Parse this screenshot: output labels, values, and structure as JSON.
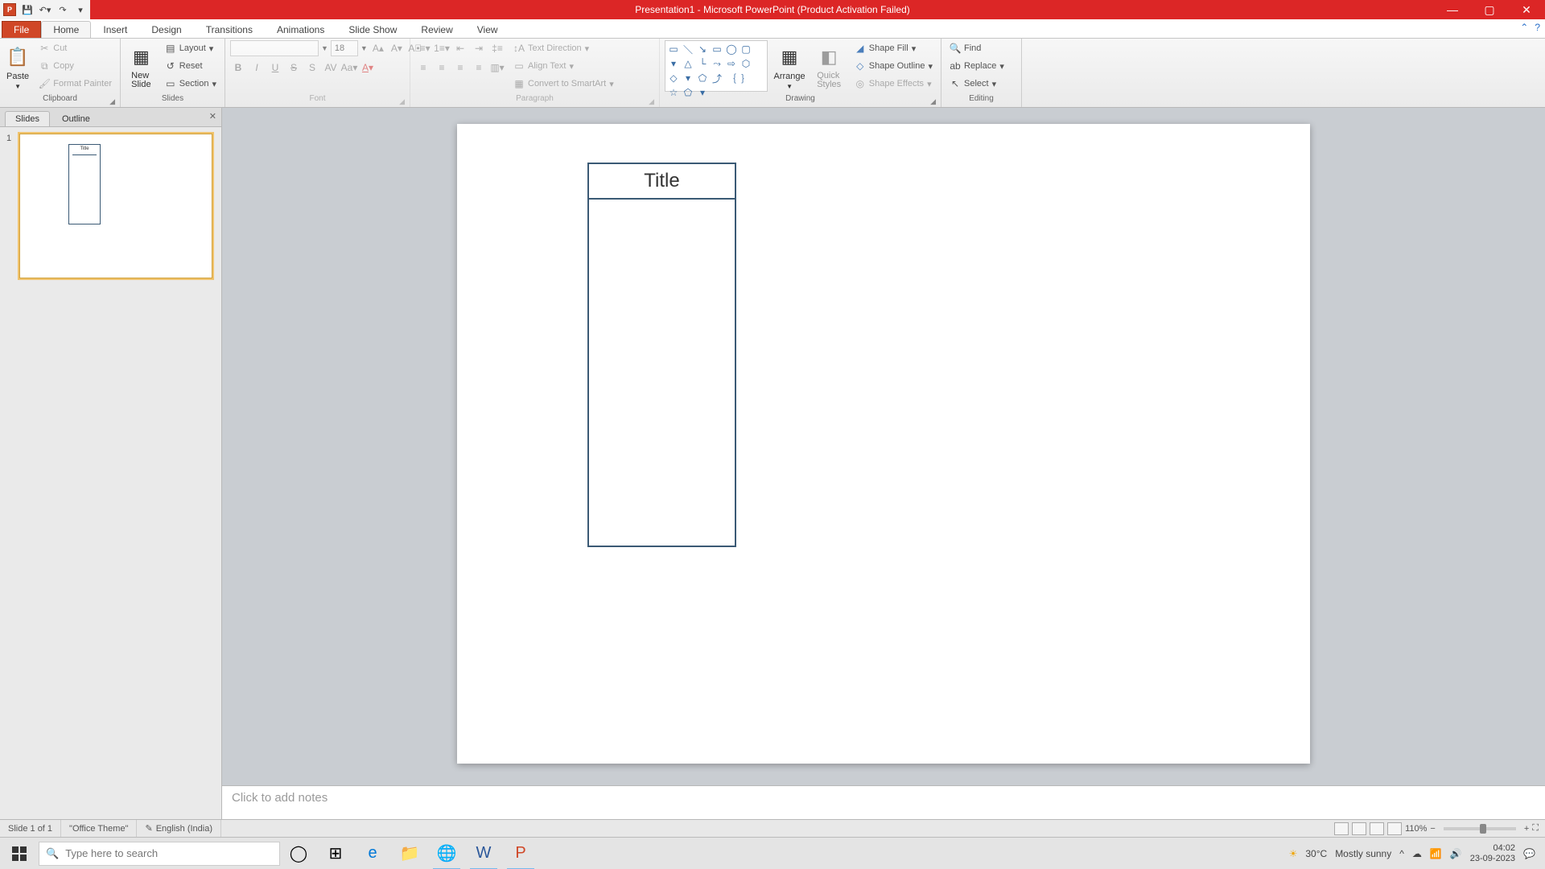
{
  "title": "Presentation1 - Microsoft PowerPoint (Product Activation Failed)",
  "tabs": {
    "file": "File",
    "home": "Home",
    "insert": "Insert",
    "design": "Design",
    "transitions": "Transitions",
    "animations": "Animations",
    "slideshow": "Slide Show",
    "review": "Review",
    "view": "View"
  },
  "ribbon": {
    "clipboard": {
      "label": "Clipboard",
      "paste": "Paste",
      "cut": "Cut",
      "copy": "Copy",
      "format_painter": "Format Painter"
    },
    "slides": {
      "label": "Slides",
      "new_slide": "New\nSlide",
      "layout": "Layout",
      "reset": "Reset",
      "section": "Section"
    },
    "font": {
      "label": "Font",
      "size": "18"
    },
    "paragraph": {
      "label": "Paragraph",
      "text_direction": "Text Direction",
      "align_text": "Align Text",
      "convert": "Convert to SmartArt"
    },
    "drawing": {
      "label": "Drawing",
      "arrange": "Arrange",
      "quick_styles": "Quick\nStyles",
      "shape_fill": "Shape Fill",
      "shape_outline": "Shape Outline",
      "shape_effects": "Shape Effects"
    },
    "editing": {
      "label": "Editing",
      "find": "Find",
      "replace": "Replace",
      "select": "Select"
    }
  },
  "panel": {
    "slides_tab": "Slides",
    "outline_tab": "Outline",
    "slide_num": "1",
    "thumb_title": "Title"
  },
  "slide": {
    "title_text": "Title"
  },
  "notes": {
    "placeholder": "Click to add notes"
  },
  "status": {
    "slide": "Slide 1 of 1",
    "theme": "\"Office Theme\"",
    "lang": "English (India)",
    "zoom": "110%"
  },
  "taskbar": {
    "search_placeholder": "Type here to search",
    "weather_temp": "30°C",
    "weather_desc": "Mostly sunny",
    "time": "04:02",
    "date": "23-09-2023"
  }
}
